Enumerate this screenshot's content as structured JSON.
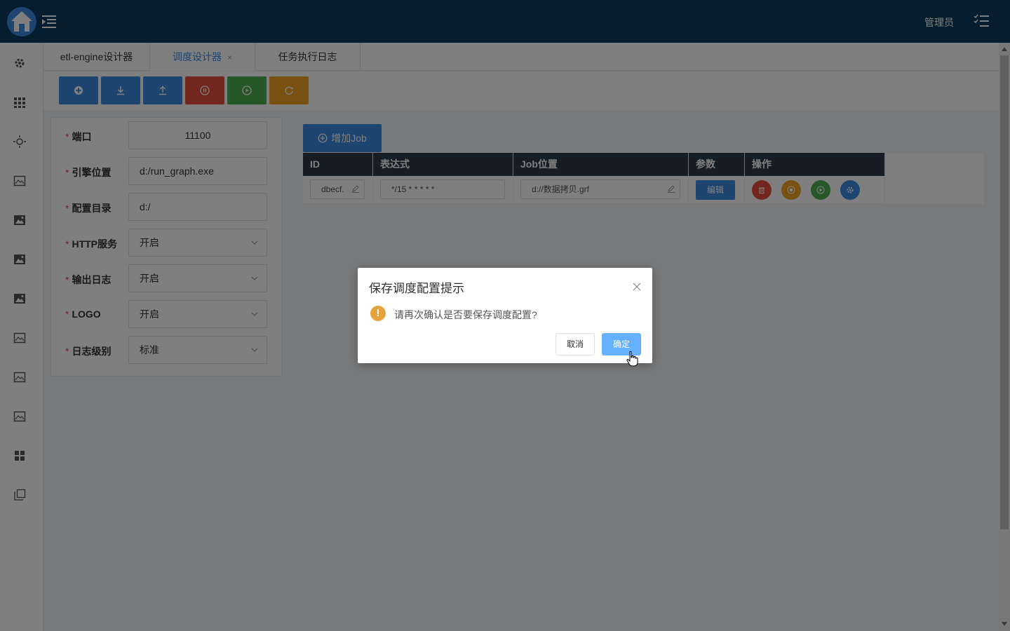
{
  "header": {
    "admin_label": "管理员"
  },
  "tabs": [
    {
      "label": "etl-engine设计器"
    },
    {
      "label": "调度设计器",
      "close": "×"
    },
    {
      "label": "任务执行日志"
    }
  ],
  "toolbar": {
    "buttons": [
      {
        "icon": "add-circle-icon",
        "color": "#3c8be0"
      },
      {
        "icon": "download-icon",
        "color": "#3c8be0"
      },
      {
        "icon": "upload-icon",
        "color": "#3c8be0"
      },
      {
        "icon": "pause-icon",
        "color": "#e74c3c"
      },
      {
        "icon": "play-icon",
        "color": "#4caf50"
      },
      {
        "icon": "refresh-icon",
        "color": "#f0a020"
      }
    ]
  },
  "form": {
    "required_mark": "*",
    "port": {
      "label": "端口",
      "value": "11100"
    },
    "engine_path": {
      "label": "引擎位置",
      "value": "d:/run_graph.exe"
    },
    "config_dir": {
      "label": "配置目录",
      "value": "d:/"
    },
    "http_service": {
      "label": "HTTP服务",
      "value": "开启"
    },
    "output_log": {
      "label": "输出日志",
      "value": "开启"
    },
    "logo": {
      "label": "LOGO",
      "value": "开启"
    },
    "log_level": {
      "label": "日志级别",
      "value": "标准"
    }
  },
  "jobs": {
    "add_label": "增加Job",
    "columns": [
      "ID",
      "表达式",
      "Job位置",
      "参数",
      "操作"
    ],
    "rows": [
      {
        "id": "dbecf.",
        "expression": "*/15 * * * * *",
        "job_path": "d://数据拷贝.grf",
        "params_label": "编辑"
      }
    ]
  },
  "dialog": {
    "title": "保存调度配置提示",
    "warn_symbol": "!",
    "message": "请再次确认是否要保存调度配置?",
    "cancel_label": "取消",
    "ok_label": "确定"
  },
  "colors": {
    "header_bg": "#0a3a5c",
    "accent": "#3c8be0",
    "danger": "#e74c3c",
    "success": "#4caf50",
    "warning": "#f0a020"
  }
}
